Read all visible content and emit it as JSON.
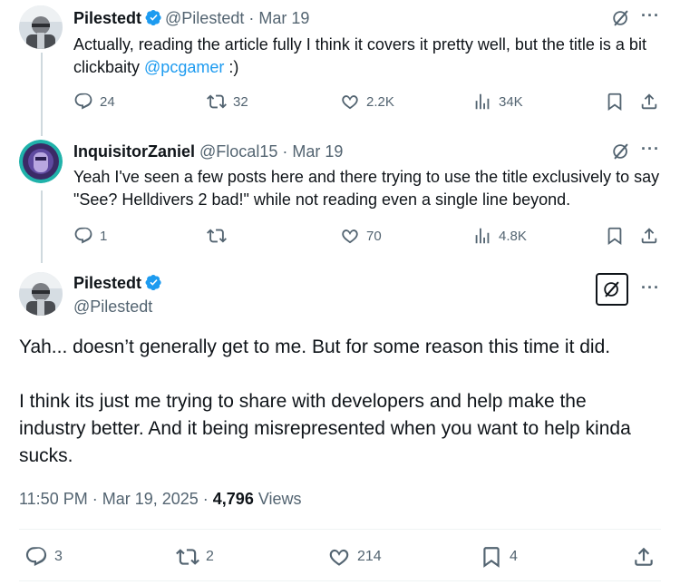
{
  "colors": {
    "accent": "#1d9bf0",
    "muted": "#536471",
    "text": "#0f1419"
  },
  "tweets": [
    {
      "name": "Pilestedt",
      "handle": "@Pilestedt",
      "date": "· Mar 19",
      "text_before": "Actually, reading the article fully I think it covers it pretty well, but the title is a bit clickbaity ",
      "mention": "@pcgamer",
      "text_after": " :)",
      "replies": "24",
      "reposts": "32",
      "likes": "2.2K",
      "views": "34K"
    },
    {
      "name": "InquisitorZaniel",
      "handle": "@Flocal15",
      "date": "· Mar 19",
      "text": "Yeah I've seen a few posts here and there trying to use the title exclusively to say \"See?  Helldivers 2 bad!\" while not reading even a single line beyond.",
      "replies": "1",
      "reposts": "",
      "likes": "70",
      "views": "4.8K"
    }
  ],
  "main": {
    "name": "Pilestedt",
    "handle": "@Pilestedt",
    "para1": "Yah... doesn’t generally get to me. But for some reason this time it did.",
    "para2": "I think its just me trying to share with developers and help make the industry better. And it being misrepresented when you want to help kinda sucks.",
    "time": "11:50 PM · Mar 19, 2025 · ",
    "views_count": "4,796",
    "views_label": " Views",
    "replies": "3",
    "reposts": "2",
    "likes": "214",
    "bookmarks": "4"
  },
  "icons": [
    "reply-icon",
    "repost-icon",
    "like-icon",
    "views-icon",
    "bookmark-icon",
    "share-icon",
    "grok-icon",
    "more-icon",
    "verified-icon"
  ]
}
